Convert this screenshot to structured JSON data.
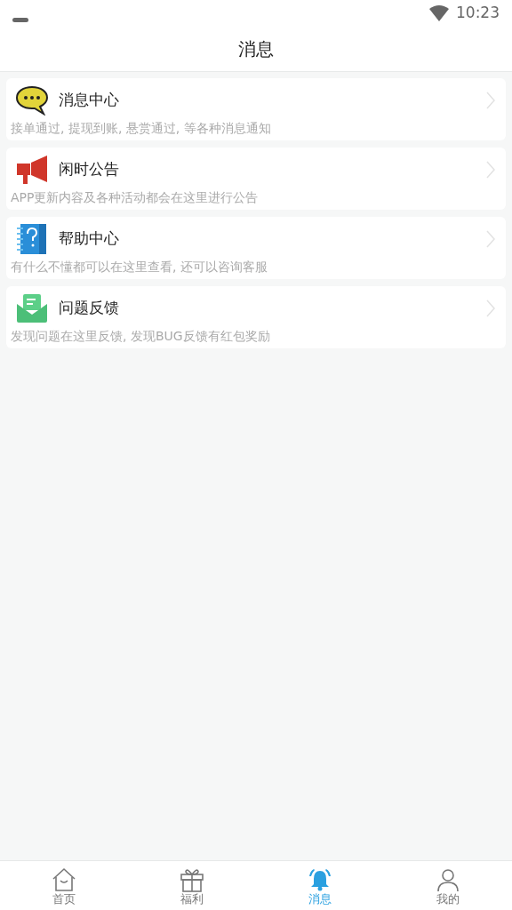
{
  "status_bar": {
    "time": "10:23"
  },
  "header": {
    "title": "消息"
  },
  "items": [
    {
      "kind": "chat",
      "title": "消息中心",
      "description": "接单通过, 提现到账, 悬赏通过, 等各种消息通知"
    },
    {
      "kind": "megaphone",
      "title": "闲时公告",
      "description": "APP更新内容及各种活动都会在这里进行公告"
    },
    {
      "kind": "help",
      "title": "帮助中心",
      "description": "有什么不懂都可以在这里查看, 还可以咨询客服"
    },
    {
      "kind": "mail",
      "title": "问题反馈",
      "description": "发现问题在这里反馈, 发现BUG反馈有红包奖励"
    }
  ],
  "tab_bar": [
    {
      "kind": "home",
      "label": "首页",
      "selected": false
    },
    {
      "kind": "gift",
      "label": "福利",
      "selected": false
    },
    {
      "kind": "bell",
      "label": "消息",
      "selected": true
    },
    {
      "kind": "person",
      "label": "我的",
      "selected": false
    }
  ]
}
